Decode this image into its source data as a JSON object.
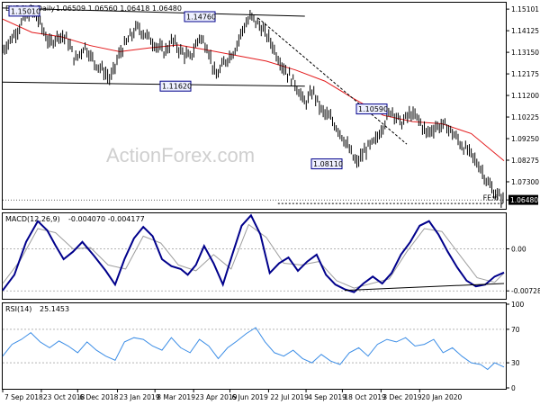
{
  "colors": {
    "background": "#ffffff",
    "price_line": "#000000",
    "ma": "#e31a1c",
    "macd_line": "#00008b",
    "signal_line": "#9e9e9e",
    "rsi_line": "#3b8de6",
    "annotation_border": "#00008b",
    "annotation_fill": "#eef0ff",
    "price_tag_fill": "#000000",
    "price_tag_text": "#ffffff"
  },
  "watermark": "ActionForex.com",
  "chart_data": [
    {
      "type": "line",
      "panel": "price",
      "header": {
        "symbol": "EURCHF,Daily",
        "values": "1.06509 1.06560 1.06418 1.06480"
      },
      "y_ticks": [
        "1.15101",
        "1.14125",
        "1.13150",
        "1.12175",
        "1.11200",
        "1.10225",
        "1.09250",
        "1.08275",
        "1.07300",
        "1.06480"
      ],
      "ylim": [
        1.0612,
        1.1535
      ],
      "current_price": 1.0648,
      "current_price_label": "1.06480",
      "annotations": [
        {
          "label": "1.15010",
          "value": 1.1501
        },
        {
          "label": "1.14760",
          "value": 1.1476
        },
        {
          "label": "1.11620",
          "value": 1.1162
        },
        {
          "label": "1.10590",
          "value": 1.1059
        },
        {
          "label": "1.08110",
          "value": 1.0811
        }
      ],
      "fib_label": "FE:6",
      "series": [
        {
          "x_index": [
            0,
            10,
            18,
            25,
            32,
            40,
            48,
            55,
            62,
            70,
            78,
            85,
            92,
            100,
            108,
            115,
            122,
            130,
            138,
            145,
            152,
            160,
            168,
            175,
            182,
            190,
            198,
            205,
            212,
            220,
            228,
            235,
            242,
            250,
            258,
            265,
            272,
            280,
            288,
            295,
            302,
            310,
            318,
            325,
            332,
            340,
            348,
            355,
            362,
            370,
            378,
            385,
            392,
            400,
            408,
            415,
            420,
            428
          ],
          "values": [
            1.1325,
            1.1395,
            1.1462,
            1.1501,
            1.1445,
            1.1352,
            1.1395,
            1.1375,
            1.1278,
            1.1345,
            1.1272,
            1.1238,
            1.1192,
            1.1312,
            1.1378,
            1.1428,
            1.1395,
            1.1352,
            1.1315,
            1.1368,
            1.132,
            1.1288,
            1.1385,
            1.1338,
            1.1202,
            1.1275,
            1.1325,
            1.142,
            1.1476,
            1.1432,
            1.1372,
            1.1292,
            1.1228,
            1.1172,
            1.1082,
            1.114,
            1.1052,
            1.1015,
            1.0955,
            1.0885,
            1.0811,
            1.0875,
            1.0912,
            1.0988,
            1.1059,
            1.0992,
            1.1038,
            1.1012,
            1.0948,
            1.098,
            1.0985,
            1.0945,
            1.0895,
            1.0852,
            1.0792,
            1.0718,
            1.068,
            1.0648
          ]
        },
        {
          "x_index": [
            0,
            25,
            50,
            75,
            100,
            125,
            150,
            175,
            200,
            225,
            250,
            275,
            300,
            325,
            350,
            375,
            400,
            428
          ],
          "values": [
            1.1465,
            1.1405,
            1.1385,
            1.1345,
            1.1318,
            1.1335,
            1.1348,
            1.1325,
            1.13,
            1.1275,
            1.1235,
            1.1185,
            1.1105,
            1.103,
            1.1002,
            1.0992,
            1.0948,
            1.0825
          ]
        }
      ]
    },
    {
      "type": "line",
      "panel": "macd",
      "header": {
        "name": "MACD(12,26,9)",
        "values": "-0.004070 -0.004177"
      },
      "y_ticks": [
        "0.00",
        "-0.007285"
      ],
      "ylim": [
        -0.0085,
        0.006
      ],
      "series": [
        {
          "x_index": [
            0,
            10,
            20,
            30,
            38,
            45,
            52,
            60,
            68,
            78,
            88,
            96,
            104,
            112,
            120,
            128,
            136,
            144,
            152,
            158,
            165,
            172,
            180,
            188,
            196,
            204,
            212,
            220,
            228,
            236,
            244,
            252,
            260,
            268,
            276,
            284,
            292,
            300,
            308,
            316,
            324,
            332,
            340,
            348,
            356,
            364,
            372,
            380,
            388,
            396,
            404,
            412,
            420,
            428
          ],
          "values": [
            -0.0072,
            -0.0045,
            0.0012,
            0.0048,
            0.0032,
            0.0006,
            -0.0018,
            -0.0005,
            0.0012,
            -0.0012,
            -0.0038,
            -0.0062,
            -0.0018,
            0.0018,
            0.0038,
            0.0022,
            -0.0018,
            -0.003,
            -0.0035,
            -0.0045,
            -0.0028,
            0.0005,
            -0.0025,
            -0.0062,
            -0.001,
            0.004,
            0.0058,
            0.0025,
            -0.0042,
            -0.0025,
            -0.0015,
            -0.0038,
            -0.0022,
            -0.001,
            -0.0045,
            -0.0062,
            -0.007,
            -0.0075,
            -0.006,
            -0.0048,
            -0.006,
            -0.0042,
            -0.001,
            0.0012,
            0.004,
            0.0048,
            0.0025,
            -0.0005,
            -0.0032,
            -0.0055,
            -0.0065,
            -0.0062,
            -0.0048,
            -0.0041
          ]
        },
        {
          "x_index": [
            0,
            15,
            30,
            45,
            60,
            75,
            90,
            105,
            120,
            135,
            150,
            165,
            180,
            195,
            210,
            225,
            240,
            255,
            270,
            285,
            300,
            315,
            330,
            345,
            360,
            375,
            390,
            405,
            420,
            428
          ],
          "values": [
            -0.006,
            -0.002,
            0.0035,
            0.0028,
            0.0,
            0.0002,
            -0.0028,
            -0.0035,
            0.0022,
            0.001,
            -0.0028,
            -0.0038,
            -0.001,
            -0.0035,
            0.0042,
            0.002,
            -0.0025,
            -0.0028,
            -0.0022,
            -0.0055,
            -0.0068,
            -0.006,
            -0.0052,
            -0.0005,
            0.0035,
            0.003,
            -0.001,
            -0.005,
            -0.0058,
            -0.0042
          ]
        }
      ]
    },
    {
      "type": "line",
      "panel": "rsi",
      "header": {
        "name": "RSI(14)",
        "values": "25.1453"
      },
      "y_ticks": [
        "100",
        "70",
        "30",
        "0"
      ],
      "ylim": [
        0,
        100
      ],
      "levels": [
        70,
        30
      ],
      "series": [
        {
          "x_index": [
            0,
            8,
            16,
            24,
            32,
            40,
            48,
            56,
            64,
            72,
            80,
            88,
            96,
            104,
            112,
            120,
            128,
            136,
            144,
            152,
            160,
            168,
            176,
            184,
            192,
            200,
            208,
            216,
            224,
            232,
            240,
            248,
            256,
            264,
            272,
            280,
            288,
            296,
            304,
            312,
            320,
            328,
            336,
            344,
            352,
            360,
            368,
            376,
            384,
            392,
            400,
            408,
            414,
            420,
            428
          ],
          "values": [
            38,
            52,
            58,
            66,
            55,
            48,
            56,
            50,
            42,
            55,
            45,
            38,
            33,
            55,
            60,
            58,
            50,
            45,
            60,
            48,
            42,
            58,
            50,
            35,
            48,
            56,
            65,
            72,
            55,
            42,
            38,
            45,
            35,
            30,
            40,
            32,
            28,
            42,
            48,
            38,
            52,
            58,
            55,
            60,
            50,
            52,
            58,
            42,
            48,
            38,
            30,
            28,
            22,
            30,
            25
          ]
        }
      ]
    },
    {
      "type": "axis",
      "panel": "x_axis",
      "categories": [
        "7 Sep 2018",
        "23 Oct 2018",
        "6 Dec 2018",
        "23 Jan 2019",
        "8 Mar 2019",
        "23 Apr 2019",
        "6 Jun 2019",
        "22 Jul 2019",
        "4 Sep 2019",
        "18 Oct 2019",
        "3 Dec 2019",
        "20 Jan 2020"
      ],
      "x_index": [
        0,
        33,
        64,
        98,
        130,
        163,
        194,
        227,
        259,
        290,
        323,
        356
      ]
    }
  ]
}
